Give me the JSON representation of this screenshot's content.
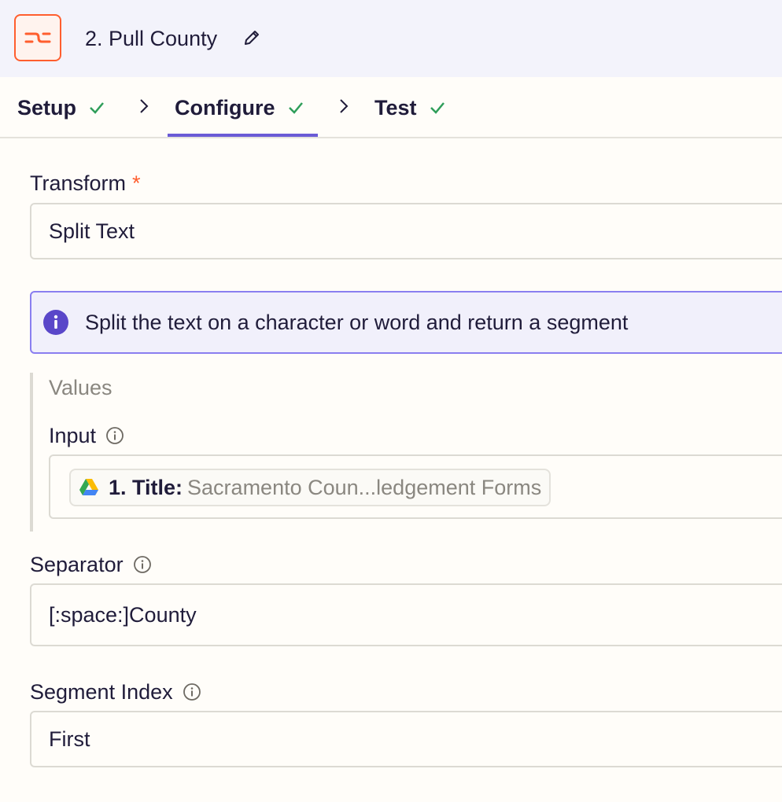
{
  "header": {
    "step_title": "2. Pull County",
    "app_icon": "formatter-icon",
    "edit_icon": "pencil-icon"
  },
  "tabs": [
    {
      "label": "Setup",
      "complete": true
    },
    {
      "label": "Configure",
      "complete": true,
      "active": true
    },
    {
      "label": "Test",
      "complete": true
    }
  ],
  "colors": {
    "accent": "#6a5bd6",
    "brand": "#ff5e2e",
    "check": "#2f9e5a"
  },
  "form": {
    "transform": {
      "label": "Transform",
      "required_mark": "*",
      "value": "Split Text"
    },
    "info": {
      "text": "Split the text on a character or word and return a segment"
    },
    "values_group": {
      "title": "Values",
      "input": {
        "label": "Input",
        "pill_key": "1. Title:",
        "pill_value": "Sacramento Coun...ledgement Forms",
        "pill_icon": "google-drive-icon"
      }
    },
    "separator": {
      "label": "Separator",
      "value": "[:space:]County"
    },
    "segment_index": {
      "label": "Segment Index",
      "value": "First"
    }
  }
}
